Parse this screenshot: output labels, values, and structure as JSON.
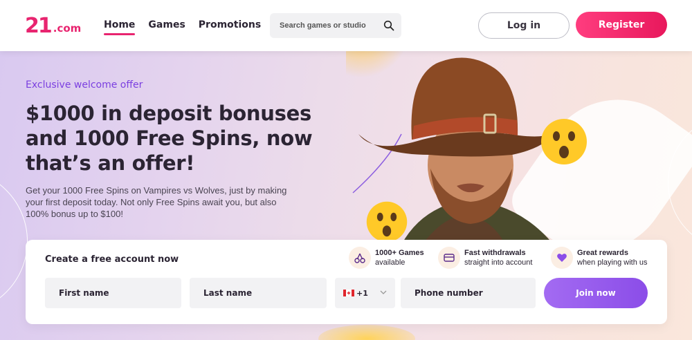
{
  "brand": {
    "mark": "21",
    "domain": ".com",
    "color": "#e8246f"
  },
  "nav": {
    "items": [
      {
        "label": "Home",
        "active": true
      },
      {
        "label": "Games",
        "active": false
      },
      {
        "label": "Promotions",
        "active": false
      }
    ]
  },
  "search": {
    "placeholder": "Search games or studio",
    "icon": "search-icon"
  },
  "auth": {
    "login_label": "Log in",
    "register_label": "Register"
  },
  "hero": {
    "eyebrow": "Exclusive welcome offer",
    "headline": "$1000 in deposit bonuses and 1000 Free Spins, now that’s an offer!",
    "description": "Get your 1000 Free Spins on Vampires vs Wolves, just by making your first deposit today. Not only Free Spins await you, but also 100% bonus up to $100!"
  },
  "signup": {
    "title": "Create a free account now",
    "features": [
      {
        "icon": "cherries-icon",
        "title": "1000+ Games",
        "subtitle": "available"
      },
      {
        "icon": "card-icon",
        "title": "Fast withdrawals",
        "subtitle": "straight into account"
      },
      {
        "icon": "heart-icon",
        "title": "Great rewards",
        "subtitle": "when playing with us"
      }
    ],
    "first_name_placeholder": "First name",
    "last_name_placeholder": "Last name",
    "country_code": "+1",
    "country_flag": "canada-flag-icon",
    "phone_placeholder": "Phone number",
    "join_label": "Join now"
  },
  "colors": {
    "accent_pink": "#e8246f",
    "accent_purple": "#8b4de8",
    "eyebrow_purple": "#7b3fe0"
  }
}
